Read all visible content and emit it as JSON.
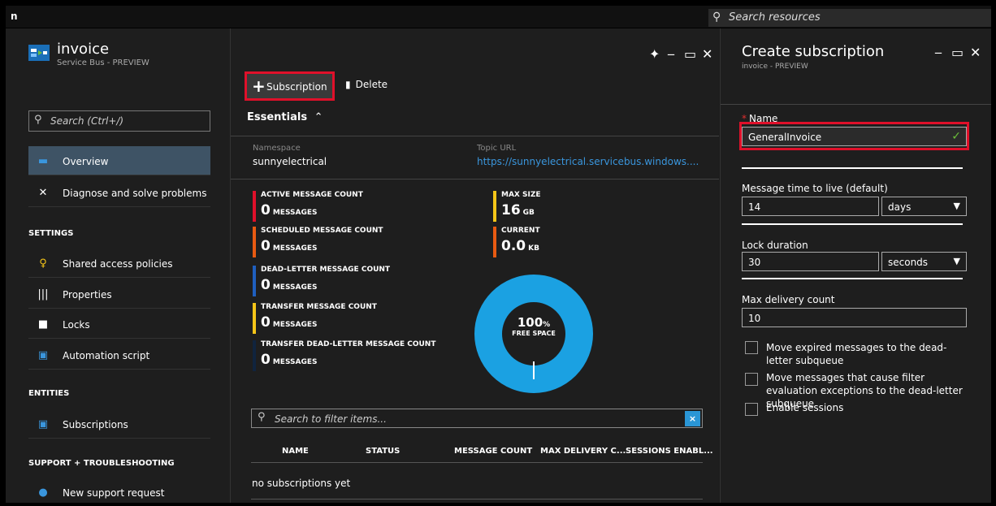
{
  "topbar": {
    "app_letter": "n",
    "search_placeholder": "Search resources"
  },
  "blade1": {
    "title": "invoice",
    "subtitle": "Service Bus - PREVIEW",
    "controls": {
      "pin": "✦",
      "minimize": "_",
      "maximize": "▭",
      "close": "✕"
    },
    "nav": {
      "search_placeholder": "Search (Ctrl+/)",
      "items": [
        {
          "label": "Overview",
          "icon": "overview-icon"
        },
        {
          "label": "Diagnose and solve problems",
          "icon": "wrench-icon"
        }
      ],
      "settings_header": "SETTINGS",
      "settings_items": [
        {
          "label": "Shared access policies",
          "icon": "key-icon"
        },
        {
          "label": "Properties",
          "icon": "properties-icon"
        },
        {
          "label": "Locks",
          "icon": "lock-icon"
        },
        {
          "label": "Automation script",
          "icon": "script-icon"
        }
      ],
      "entities_header": "ENTITIES",
      "entities_items": [
        {
          "label": "Subscriptions",
          "icon": "subscriptions-icon"
        }
      ],
      "support_header": "SUPPORT + TROUBLESHOOTING",
      "support_items": [
        {
          "label": "New support request",
          "icon": "support-icon"
        }
      ]
    },
    "toolbar": {
      "subscription_label": "Subscription",
      "delete_label": "Delete"
    },
    "essentials": {
      "title": "Essentials",
      "namespace_label": "Namespace",
      "namespace_value": "sunnyelectrical",
      "topic_url_label": "Topic URL",
      "topic_url_value": "https://sunnyelectrical.servicebus.windows...."
    },
    "metrics": [
      {
        "label": "ACTIVE MESSAGE COUNT",
        "value": "0",
        "unit": "MESSAGES",
        "color": "#e0102a"
      },
      {
        "label": "SCHEDULED MESSAGE COUNT",
        "value": "0",
        "unit": "MESSAGES",
        "color": "#e85a12"
      },
      {
        "label": "DEAD-LETTER MESSAGE COUNT",
        "value": "0",
        "unit": "MESSAGES",
        "color": "#1f5fbf"
      },
      {
        "label": "TRANSFER MESSAGE COUNT",
        "value": "0",
        "unit": "MESSAGES",
        "color": "#f5c518"
      },
      {
        "label": "TRANSFER DEAD-LETTER MESSAGE COUNT",
        "value": "0",
        "unit": "MESSAGES",
        "color": "#10243e"
      }
    ],
    "size_metrics": [
      {
        "label": "MAX SIZE",
        "value": "16",
        "unit": "GB",
        "color": "#f5c518"
      },
      {
        "label": "CURRENT",
        "value": "0.0",
        "unit": "KB",
        "color": "#e85a12"
      }
    ],
    "donut": {
      "value": "100",
      "unit": "%",
      "label": "FREE SPACE",
      "color": "#1ba1e2",
      "free_fraction": 1.0
    },
    "table": {
      "filter_placeholder": "Search to filter items...",
      "clear": "×",
      "columns": [
        "NAME",
        "STATUS",
        "MESSAGE COUNT",
        "MAX DELIVERY C...",
        "SESSIONS ENABL..."
      ],
      "empty_text": "no subscriptions yet"
    }
  },
  "blade2": {
    "title": "Create subscription",
    "subtitle": "invoice - PREVIEW",
    "controls": {
      "minimize": "_",
      "maximize": "▭",
      "close": "✕"
    },
    "name_label": "Name",
    "name_value": "GeneralInvoice",
    "ttl_label": "Message time to live (default)",
    "ttl_value": "14",
    "ttl_unit": "days",
    "lock_label": "Lock duration",
    "lock_value": "30",
    "lock_unit": "seconds",
    "maxdel_label": "Max delivery count",
    "maxdel_value": "10",
    "checkboxes": [
      {
        "label": "Move expired messages to the dead-letter subqueue",
        "checked": false
      },
      {
        "label": "Move messages that cause filter evaluation exceptions to the dead-letter subqueue",
        "checked": false
      },
      {
        "label": "Enable sessions",
        "checked": false
      }
    ]
  }
}
